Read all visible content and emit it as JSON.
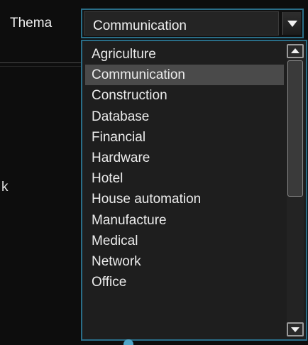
{
  "thema_label": "Thema",
  "background_fragment": "k",
  "combo": {
    "selected_value": "Communication"
  },
  "dropdown": {
    "options": [
      "Agriculture",
      "Communication",
      "Construction",
      "Database",
      "Financial",
      "Hardware",
      "Hotel",
      "House automation",
      "Manufacture",
      "Medical",
      "Network",
      "Office"
    ],
    "highlighted_index": 1
  },
  "icons": {
    "combo_toggle": "chevron-down-icon",
    "scroll_up": "arrow-up-icon",
    "scroll_down": "arrow-down-icon"
  },
  "colors": {
    "accent_border": "#2a6e88",
    "highlight": "#4a4a4a",
    "background": "#0d0d0d",
    "list_background": "#1e1e1e",
    "text": "#ececec"
  },
  "scroll": {
    "thumb_fraction": 0.51,
    "position_fraction": 0.0
  }
}
